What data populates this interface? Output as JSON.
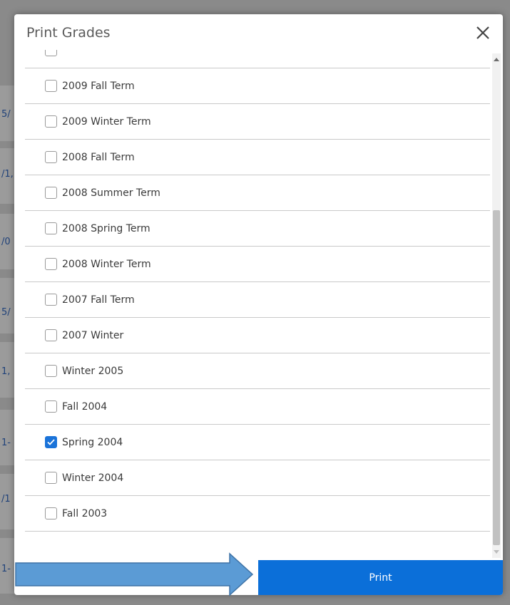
{
  "background": {
    "fragments": [
      "5/",
      "/1,",
      "/0",
      "5/",
      "1,",
      "1-",
      "/1",
      "1-"
    ]
  },
  "modal": {
    "title": "Print Grades",
    "close_icon": "close-icon",
    "terms": [
      {
        "label": "",
        "checked": false
      },
      {
        "label": "2009 Fall Term",
        "checked": false
      },
      {
        "label": "2009 Winter Term",
        "checked": false
      },
      {
        "label": "2008 Fall Term",
        "checked": false
      },
      {
        "label": "2008 Summer Term",
        "checked": false
      },
      {
        "label": "2008 Spring Term",
        "checked": false
      },
      {
        "label": "2008 Winter Term",
        "checked": false
      },
      {
        "label": "2007 Fall Term",
        "checked": false
      },
      {
        "label": "2007 Winter",
        "checked": false
      },
      {
        "label": "Winter 2005",
        "checked": false
      },
      {
        "label": "Fall 2004",
        "checked": false
      },
      {
        "label": "Spring 2004",
        "checked": true
      },
      {
        "label": "Winter 2004",
        "checked": false
      },
      {
        "label": "Fall 2003",
        "checked": false
      }
    ],
    "print_label": "Print"
  },
  "colors": {
    "accent": "#0b6fd9",
    "checkbox_checked": "#1a73d9",
    "annotation_arrow": "#5b9bd5"
  }
}
